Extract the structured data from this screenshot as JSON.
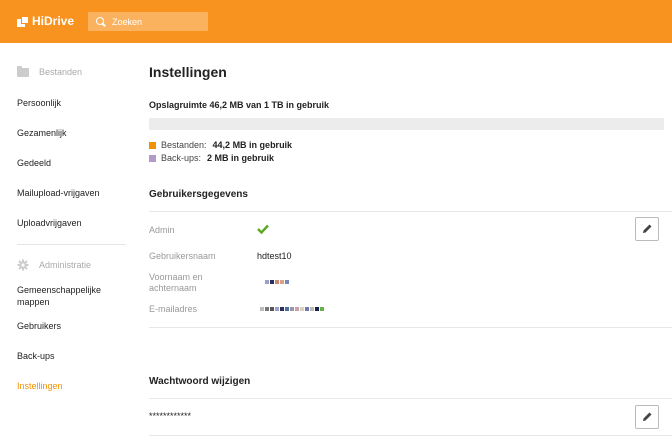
{
  "app": {
    "logo_text": "HiDrive",
    "brand_color": "#f7931e"
  },
  "search": {
    "placeholder": "Zoeken",
    "icon": "search-icon"
  },
  "sidebar": {
    "files_header": "Bestanden",
    "items": [
      {
        "label": "Persoonlijk"
      },
      {
        "label": "Gezamenlijk"
      },
      {
        "label": "Gedeeld"
      },
      {
        "label": "Mailupload-vrijgaven"
      },
      {
        "label": "Uploadvrijgaven"
      }
    ],
    "admin_header": "Administratie",
    "admin_items": [
      {
        "label": "Gemeenschappelijke mappen"
      },
      {
        "label": "Gebruikers"
      },
      {
        "label": "Back-ups"
      },
      {
        "label": "Instellingen",
        "active": true
      }
    ]
  },
  "main": {
    "title": "Instellingen",
    "storage": {
      "title": "Opslagruimte 46,2 MB van 1 TB in gebruik",
      "used_fraction": 4.62e-05,
      "legend": [
        {
          "label": "Bestanden:",
          "value": "44,2 MB in gebruik",
          "color": "#f39200"
        },
        {
          "label": "Back-ups:",
          "value": "2 MB in gebruik",
          "color": "#b39ac8"
        }
      ]
    },
    "user_section": {
      "title": "Gebruikersgegevens",
      "fields": {
        "admin_label": "Admin",
        "username_label": "Gebruikersnaam",
        "username_value": "hdtest10",
        "fullname_label": "Voornaam en achternaam",
        "email_label": "E-mailadres"
      }
    },
    "password_section": {
      "title": "Wachtwoord wijzigen",
      "masked_value": "************"
    }
  }
}
